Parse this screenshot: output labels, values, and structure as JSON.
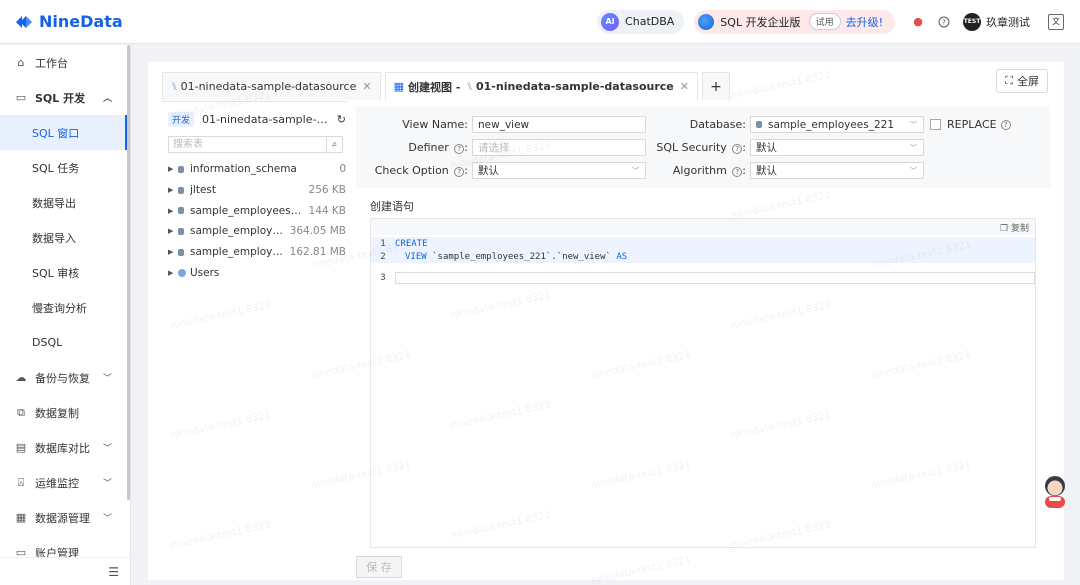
{
  "app": {
    "logo_text": "NineData",
    "brand_color": "#1463e6"
  },
  "topbar": {
    "chatdba_icon": "AI",
    "chatdba_label": "ChatDBA",
    "edition_label": "SQL 开发企业版",
    "trial_label": "试用",
    "upgrade_label": "去升级!",
    "avatar_text": "TEST",
    "user_name": "玖章测试",
    "translate_icon": "文",
    "icons": [
      "bell-icon",
      "help-icon",
      "translate-icon"
    ]
  },
  "sidebar": {
    "items": [
      {
        "label": "工作台",
        "icon": "home-icon"
      },
      {
        "label": "SQL 开发",
        "icon": "sql-dev-icon"
      },
      {
        "label": "SQL 窗口"
      },
      {
        "label": "SQL 任务"
      },
      {
        "label": "数据导出"
      },
      {
        "label": "数据导入"
      },
      {
        "label": "SQL 审核"
      },
      {
        "label": "慢查询分析"
      },
      {
        "label": "DSQL"
      },
      {
        "label": "备份与恢复",
        "icon": "backup-icon"
      },
      {
        "label": "数据复制",
        "icon": "replicate-icon"
      },
      {
        "label": "数据库对比",
        "icon": "compare-icon"
      },
      {
        "label": "运维监控",
        "icon": "monitor-icon"
      },
      {
        "label": "数据源管理",
        "icon": "datasource-icon"
      },
      {
        "label": "账户管理",
        "icon": "account-icon"
      }
    ],
    "active_index": 2
  },
  "tabs": [
    {
      "label": "01-ninedata-sample-datasource"
    },
    {
      "prefix": "创建视图 -",
      "label": "01-ninedata-sample-datasource"
    }
  ],
  "toolbar": {
    "fullscreen_label": "全屏"
  },
  "tree": {
    "env_badge": "开发",
    "datasource": "01-ninedata-sample-data...",
    "search_placeholder": "搜索表",
    "nodes": [
      {
        "name": "information_schema",
        "size": "0"
      },
      {
        "name": "jltest",
        "size": "256 KB"
      },
      {
        "name": "sample_employees_...",
        "size": "144 KB"
      },
      {
        "name": "sample_employe...",
        "size": "364.05 MB"
      },
      {
        "name": "sample_employe...",
        "size": "162.81 MB"
      },
      {
        "name": "Users",
        "size": ""
      }
    ]
  },
  "form": {
    "view_name_label": "View Name:",
    "view_name_value": "new_view",
    "definer_label": "Definer",
    "definer_placeholder": "请选择",
    "check_option_label": "Check Option",
    "check_option_value": "默认",
    "database_label": "Database:",
    "database_value": "sample_employees_221",
    "replace_label": "REPLACE",
    "sql_security_label": "SQL Security",
    "sql_security_value": "默认",
    "algorithm_label": "Algorithm",
    "algorithm_value": "默认"
  },
  "editor": {
    "title": "创建语句",
    "copy_label": "复制",
    "lines": [
      {
        "num": "1",
        "kw": "CREATE",
        "rest": ""
      },
      {
        "num": "2",
        "kw": "VIEW",
        "rest": " `sample_employees_221`.`new_view` ",
        "kw2": "AS"
      },
      {
        "num": "3",
        "kw": "",
        "rest": ""
      }
    ]
  },
  "footer": {
    "save_label": "保 存"
  },
  "watermark": "ninedata-test1 8321"
}
